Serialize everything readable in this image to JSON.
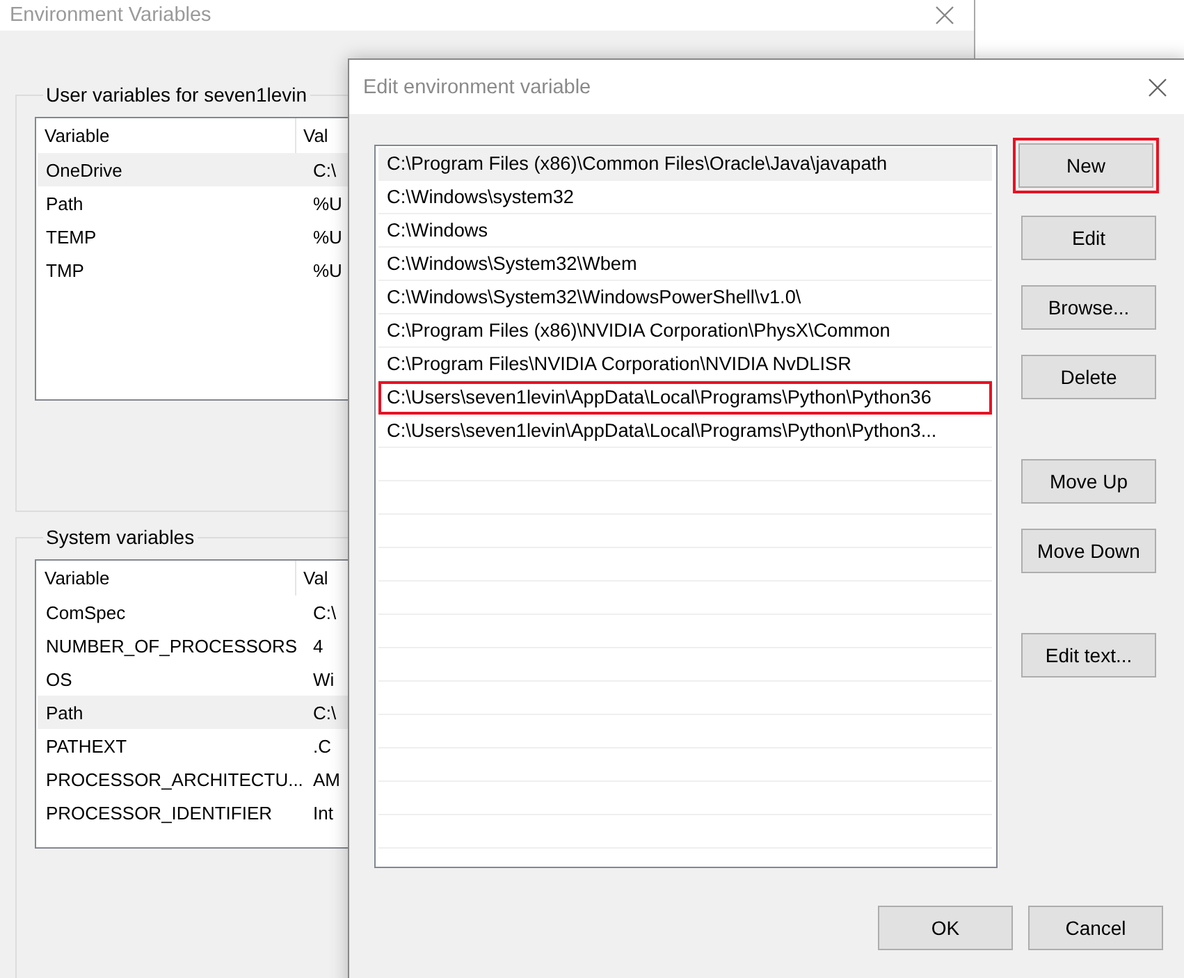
{
  "background_window": {
    "title": "Environment Variables",
    "groups": [
      {
        "label": "User variables for seven1levin",
        "columns": [
          "Variable",
          "Val"
        ],
        "rows": [
          {
            "variable": "OneDrive",
            "value": "C:\\",
            "selected": true
          },
          {
            "variable": "Path",
            "value": "%U",
            "selected": false
          },
          {
            "variable": "TEMP",
            "value": "%U",
            "selected": false
          },
          {
            "variable": "TMP",
            "value": "%U",
            "selected": false
          }
        ]
      },
      {
        "label": "System variables",
        "columns": [
          "Variable",
          "Val"
        ],
        "rows": [
          {
            "variable": "ComSpec",
            "value": "C:\\",
            "selected": false
          },
          {
            "variable": "NUMBER_OF_PROCESSORS",
            "value": "4",
            "selected": false
          },
          {
            "variable": "OS",
            "value": "Wi",
            "selected": false
          },
          {
            "variable": "Path",
            "value": "C:\\",
            "selected": true
          },
          {
            "variable": "PATHEXT",
            "value": ".C",
            "selected": false
          },
          {
            "variable": "PROCESSOR_ARCHITECTU...",
            "value": "AM",
            "selected": false
          },
          {
            "variable": "PROCESSOR_IDENTIFIER",
            "value": "Int",
            "selected": false
          }
        ]
      }
    ]
  },
  "dialog": {
    "title": "Edit environment variable",
    "entries": [
      {
        "text": "C:\\Program Files (x86)\\Common Files\\Oracle\\Java\\javapath",
        "selected": true,
        "annotated": false
      },
      {
        "text": "C:\\Windows\\system32",
        "selected": false,
        "annotated": false
      },
      {
        "text": "C:\\Windows",
        "selected": false,
        "annotated": false
      },
      {
        "text": "C:\\Windows\\System32\\Wbem",
        "selected": false,
        "annotated": false
      },
      {
        "text": "C:\\Windows\\System32\\WindowsPowerShell\\v1.0\\",
        "selected": false,
        "annotated": false
      },
      {
        "text": "C:\\Program Files (x86)\\NVIDIA Corporation\\PhysX\\Common",
        "selected": false,
        "annotated": false
      },
      {
        "text": "C:\\Program Files\\NVIDIA Corporation\\NVIDIA NvDLISR",
        "selected": false,
        "annotated": false
      },
      {
        "text": "C:\\Users\\seven1levin\\AppData\\Local\\Programs\\Python\\Python36",
        "selected": false,
        "annotated": true
      },
      {
        "text": "C:\\Users\\seven1levin\\AppData\\Local\\Programs\\Python\\Python3...",
        "selected": false,
        "annotated": false
      }
    ],
    "button_groups": [
      [
        {
          "label": "New",
          "annotated": true
        },
        {
          "label": "Edit",
          "annotated": false
        },
        {
          "label": "Browse...",
          "annotated": false
        },
        {
          "label": "Delete",
          "annotated": false
        }
      ],
      [
        {
          "label": "Move Up",
          "annotated": false
        },
        {
          "label": "Move Down",
          "annotated": false
        }
      ],
      [
        {
          "label": "Edit text...",
          "annotated": false
        }
      ]
    ],
    "footer_buttons": [
      "OK",
      "Cancel"
    ]
  }
}
